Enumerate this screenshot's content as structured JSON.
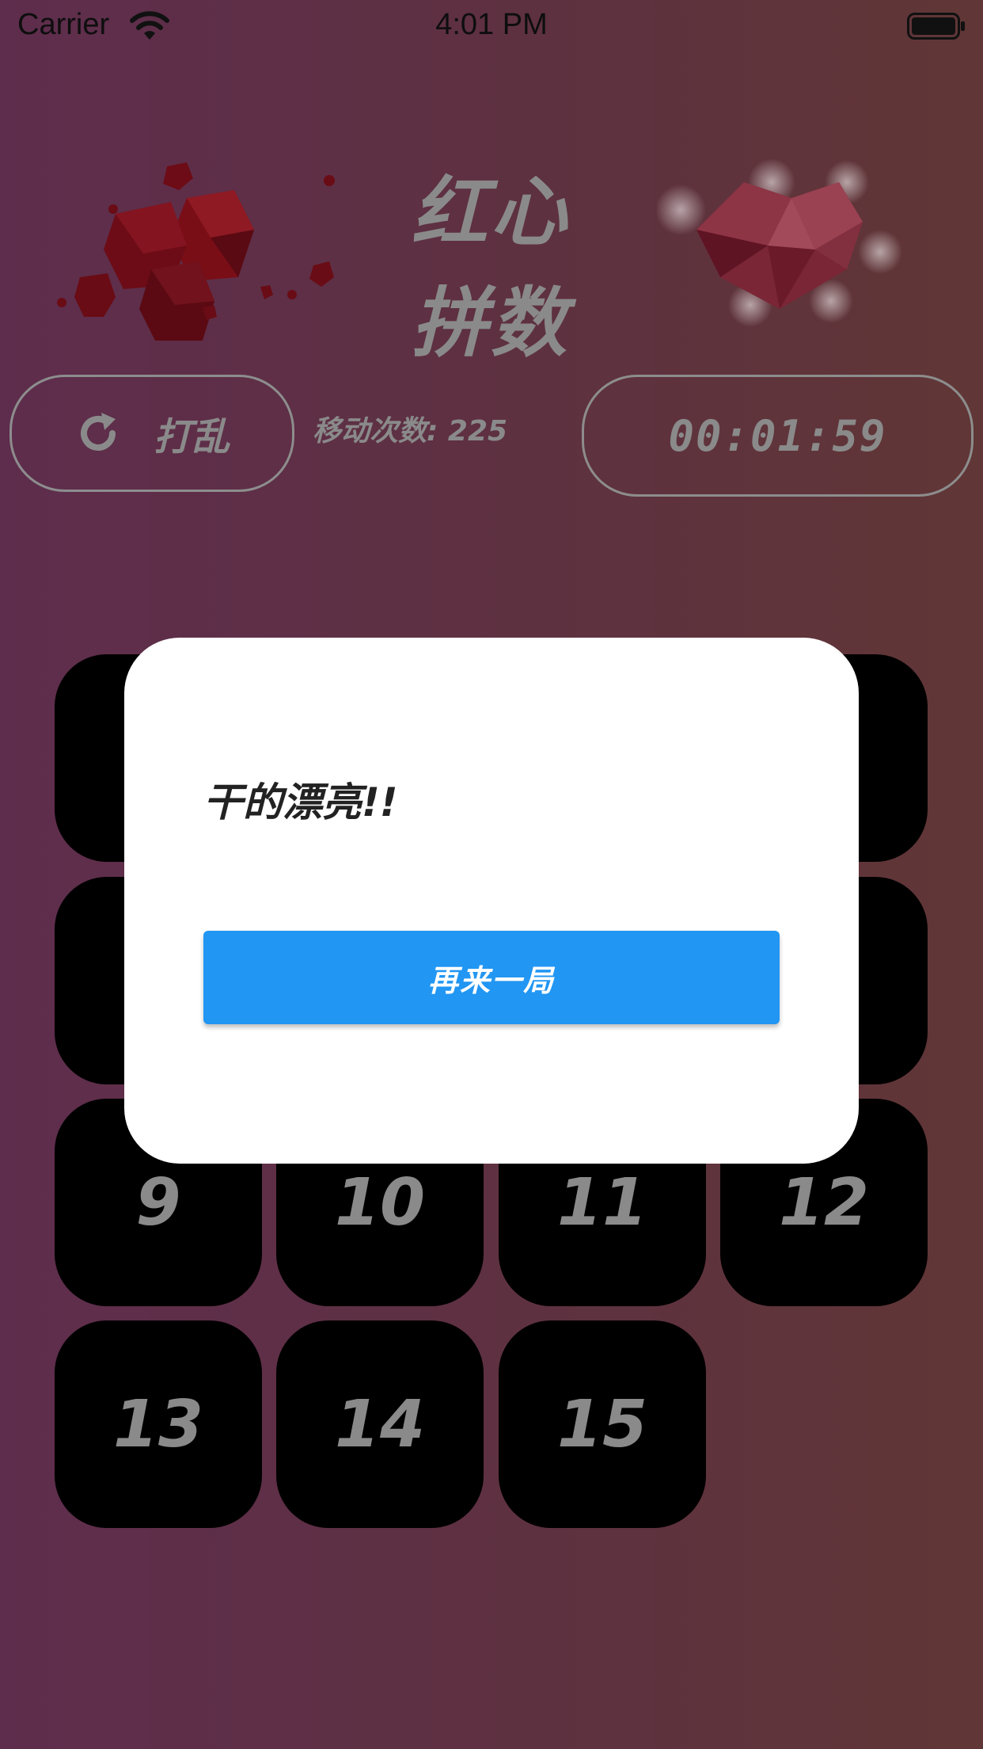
{
  "status_bar": {
    "carrier": "Carrier",
    "time": "4:01 PM"
  },
  "header": {
    "title_line1": "红心",
    "title_line2": "拼数"
  },
  "controls": {
    "shuffle_label": "打乱",
    "moves_text": "移动次数: 225",
    "timer": "00:01:59"
  },
  "grid": {
    "tiles": [
      "9",
      "10",
      "11",
      "12",
      "13",
      "14",
      "15"
    ]
  },
  "dialog": {
    "message": "干的漂亮!!",
    "button_label": "再来一局"
  },
  "colors": {
    "accent": "#2196f3",
    "tile": "#000000",
    "tile_text": "#8a8a8a"
  }
}
